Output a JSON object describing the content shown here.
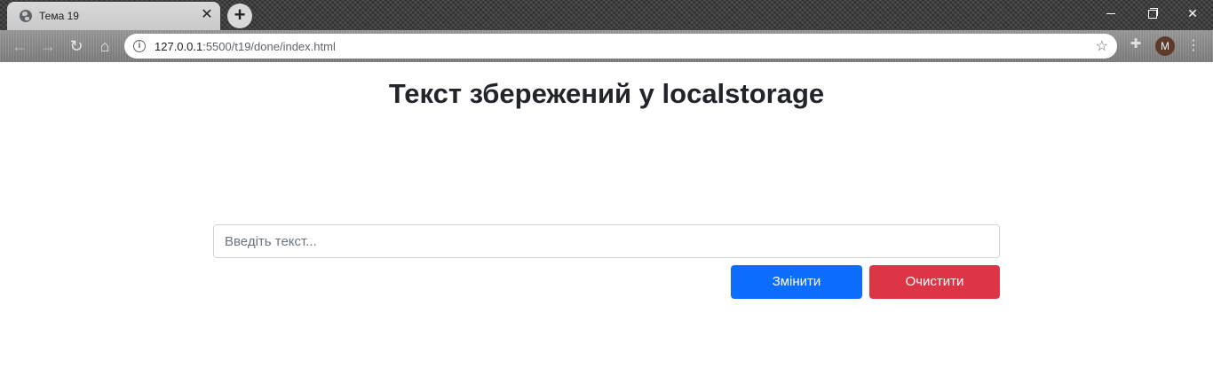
{
  "browser": {
    "tab_title": "Тема 19",
    "tab_close": "✕",
    "new_tab": "+",
    "url_host": "127.0.0.1",
    "url_rest": ":5500/t19/done/index.html",
    "avatar_letter": "M",
    "icons": {
      "back": "arrow-left-icon",
      "forward": "arrow-right-icon",
      "reload": "reload-icon",
      "home": "home-icon",
      "info": "info-icon",
      "star": "star-icon",
      "extensions": "puzzle-icon",
      "menu": "kebab-menu-icon"
    }
  },
  "page": {
    "title": "Текст збережений у localstorage",
    "input_placeholder": "Введіть текст...",
    "input_value": "",
    "change_button": "Змінити",
    "clear_button": "Очистити"
  },
  "colors": {
    "primary": "#0d6efd",
    "danger": "#dc3545",
    "text": "#212529"
  }
}
